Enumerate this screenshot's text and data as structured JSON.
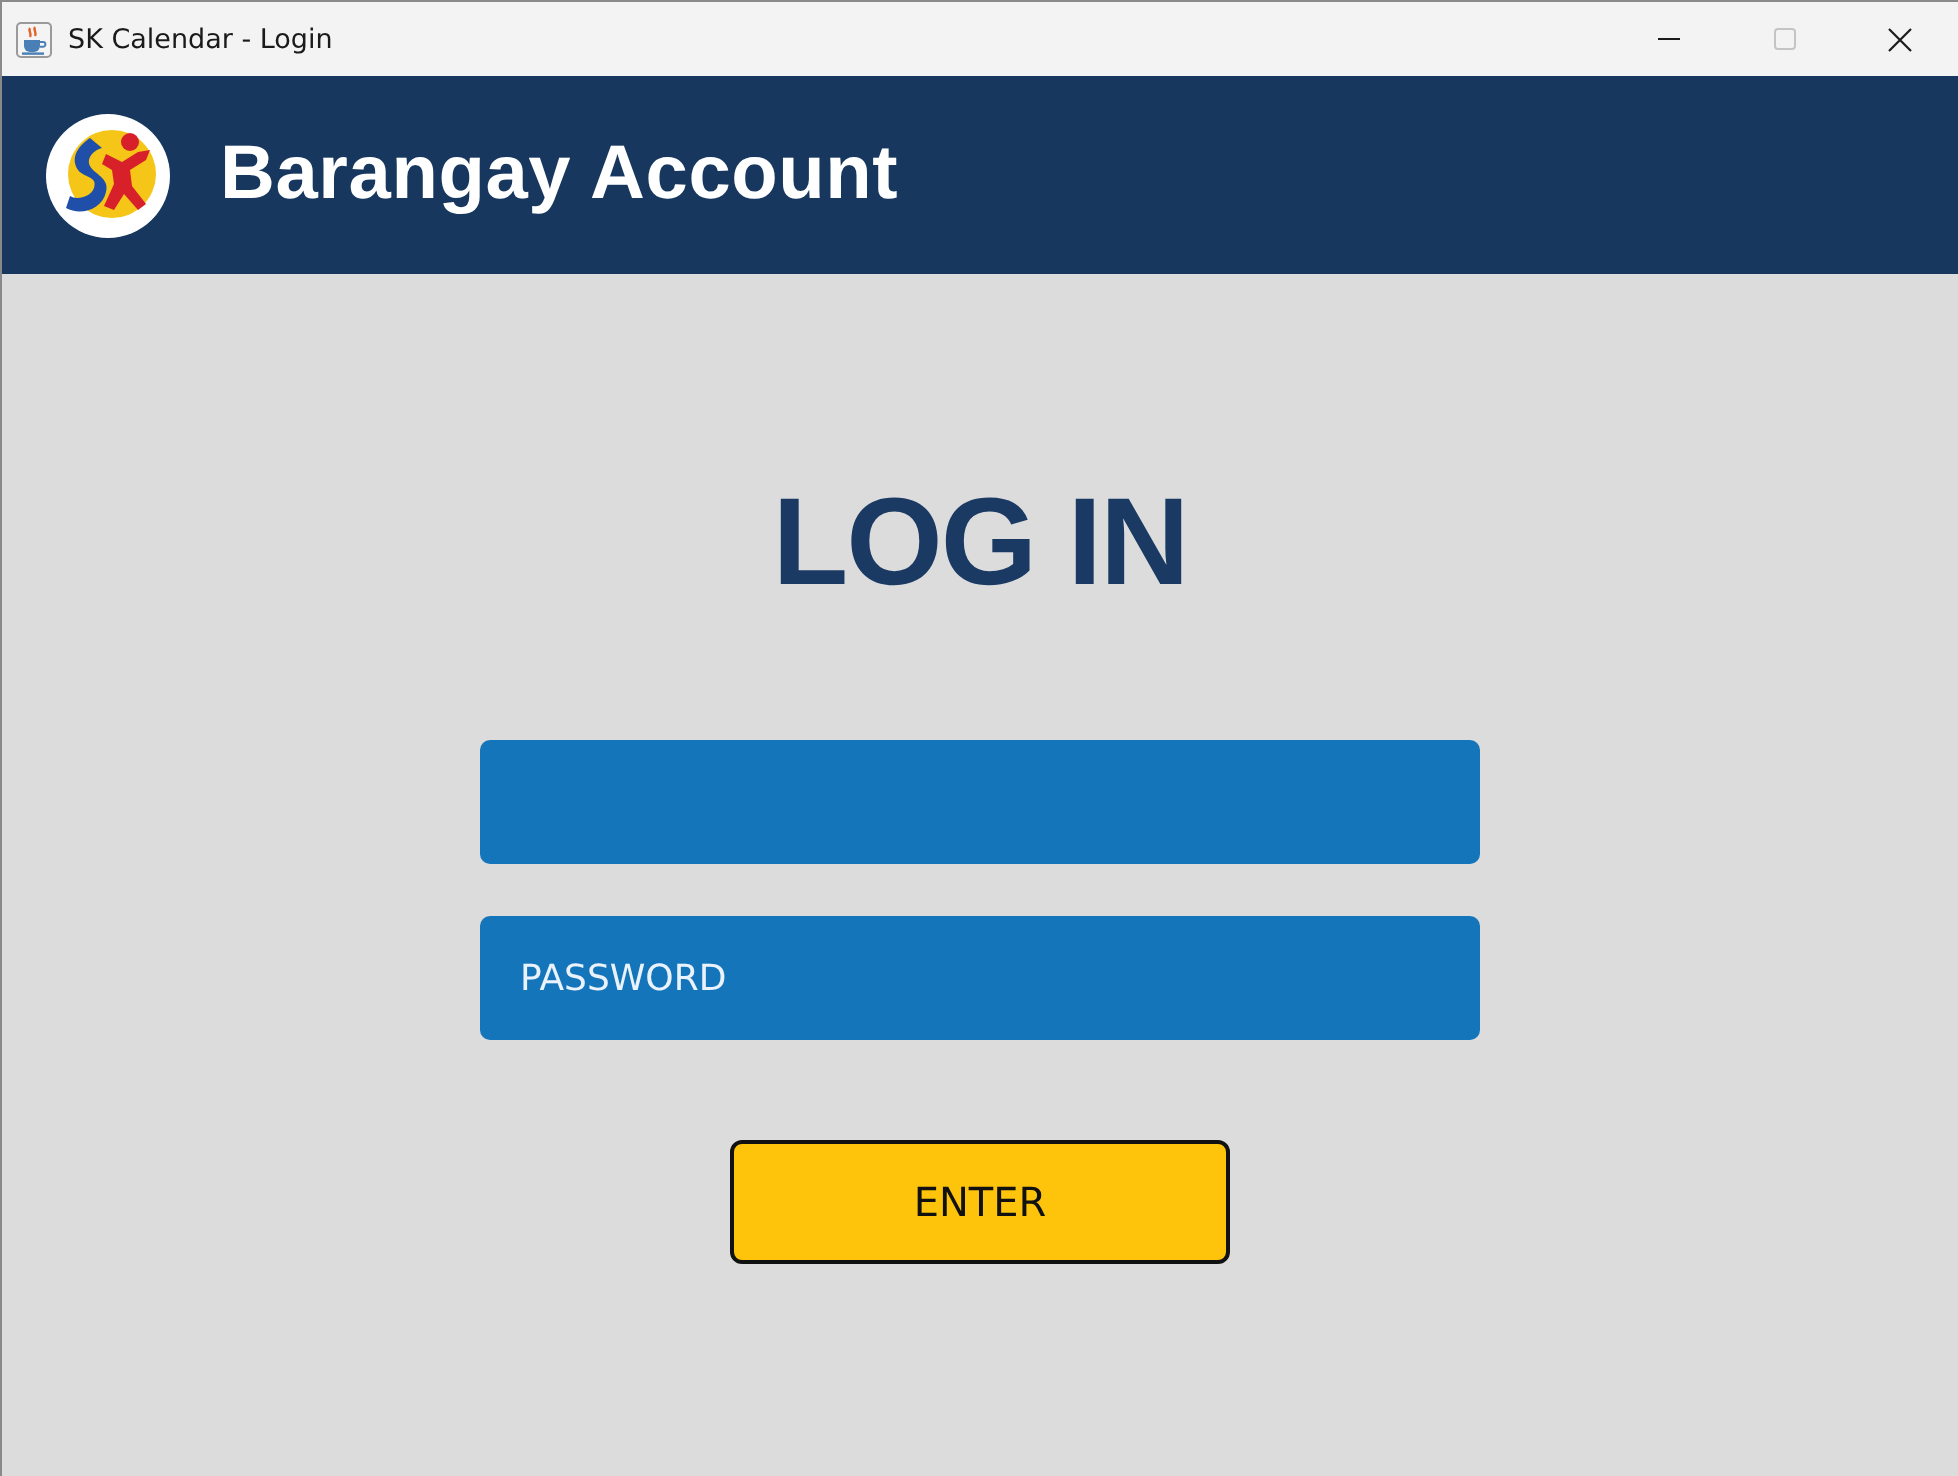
{
  "window": {
    "title": "SK Calendar - Login",
    "controls": [
      {
        "kind": "minimize",
        "disabled": false
      },
      {
        "kind": "maximize",
        "disabled": true
      },
      {
        "kind": "close",
        "disabled": false
      }
    ]
  },
  "header": {
    "title": "Barangay Account"
  },
  "login": {
    "heading": "LOG IN",
    "password_field": {
      "placeholder": "PASSWORD"
    },
    "submit": "ENTER"
  }
}
